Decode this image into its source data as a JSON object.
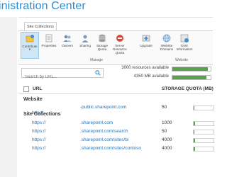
{
  "header": {
    "title": "inistration Center"
  },
  "ribbon": {
    "tab_label": "Site Collections",
    "buttons": [
      {
        "label": "Contribute",
        "has_menu": true
      },
      {
        "label": "Properties"
      },
      {
        "label": "Owners"
      },
      {
        "label": "Sharing"
      },
      {
        "label": "Storage Quota"
      },
      {
        "label": "Server Resource Quota"
      },
      {
        "label": "Upgrade"
      },
      {
        "label": "Website Domains"
      },
      {
        "label": "DNS Information"
      }
    ],
    "groups": {
      "manage": "Manage",
      "website": "Website"
    }
  },
  "search": {
    "placeholder": "Search by URL..."
  },
  "resources": {
    "server_text": "3000 resources available",
    "server_fraction": 0.92,
    "storage_text": "4350 MB available",
    "storage_fraction": 0.88
  },
  "table": {
    "columns": {
      "url": "URL",
      "quota": "STORAGE QUOTA (MB)"
    },
    "website_section": "Website",
    "website_row": {
      "url_prefix": "http://",
      "url_suffix": "-public.sharepoint.com",
      "quota": "50",
      "usage": 0.02
    },
    "collections_section": "Site Collections",
    "rows": [
      {
        "url_prefix": "https://",
        "url_suffix": ".sharepoint.com",
        "quota": "1000",
        "usage": 0.06
      },
      {
        "url_prefix": "https://",
        "url_suffix": ".sharepoint.com/search",
        "quota": "50",
        "usage": 0.02
      },
      {
        "url_prefix": "https://",
        "url_suffix": ".sharepoint.com/sites/bi",
        "quota": "4000",
        "usage": 0.07
      },
      {
        "url_prefix": "https://",
        "url_suffix": ".sharepoint.com/sites/contoso",
        "quota": "4000",
        "usage": 0.07
      }
    ]
  },
  "colors": {
    "accent": "#2a8dd4",
    "link": "#2a73b5",
    "bar_fill": "#5aa14e"
  }
}
